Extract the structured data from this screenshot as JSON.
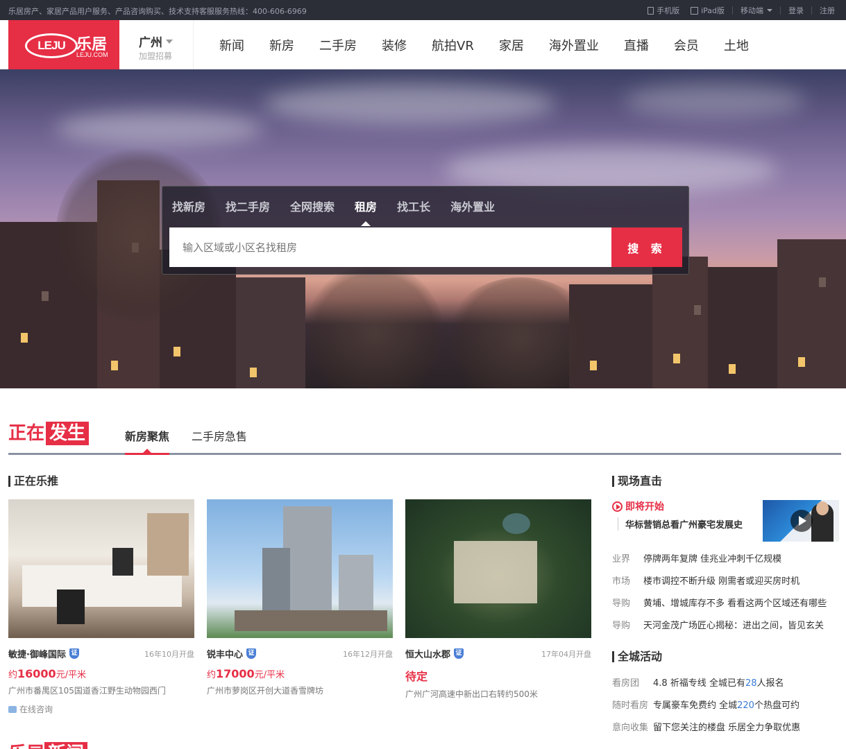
{
  "topbar": {
    "notice": "乐居房产、家居产品用户服务、产品咨询购买、技术支持客服服务热线：400-606-6969",
    "links": [
      "手机版",
      "iPad版",
      "移动端",
      "登录",
      "注册"
    ]
  },
  "header": {
    "logo_mark": "LEJU",
    "logo_cn": "乐居",
    "logo_en": "LEJU.COM",
    "city": "广州",
    "city_sub": "加盟招募",
    "nav": [
      "新闻",
      "新房",
      "二手房",
      "装修",
      "航拍VR",
      "家居",
      "海外置业",
      "直播",
      "会员",
      "土地"
    ]
  },
  "search": {
    "tabs": [
      "找新房",
      "找二手房",
      "全网搜索",
      "租房",
      "找工长",
      "海外置业"
    ],
    "active_tab": "租房",
    "placeholder": "输入区域或小区名找租房",
    "button": "搜 索"
  },
  "section": {
    "title_a": "正在",
    "title_b": "发生",
    "tabs": [
      "新房聚焦",
      "二手房急售"
    ]
  },
  "left": {
    "heading": "正在乐推",
    "cards": [
      {
        "name": "敏捷·御峰国际",
        "badge": "证",
        "date": "16年10月开盘",
        "price_prefix": "约",
        "price": "16000",
        "price_unit": "元/平米",
        "address": "广州市番禺区105国道香江野生动物园西门",
        "consult": "在线咨询"
      },
      {
        "name": "锐丰中心",
        "badge": "证",
        "date": "16年12月开盘",
        "price_prefix": "约",
        "price": "17000",
        "price_unit": "元/平米",
        "address": "广州市萝岗区开创大道香雪牌坊"
      },
      {
        "name": "恒大山水郡",
        "badge": "证",
        "date": "17年04月开盘",
        "price_status": "待定",
        "address": "广州广河高速中新出口右转约500米"
      }
    ]
  },
  "right": {
    "live_heading": "现场直击",
    "live_soon": "即将开始",
    "live_desc": "华标营销总看广州豪宅发展史",
    "news": [
      {
        "k": "业界",
        "v": "停牌两年复牌 佳兆业冲刺千亿规模"
      },
      {
        "k": "市场",
        "v": "楼市调控不断升级 刚需者或迎买房时机"
      },
      {
        "k": "导购",
        "v": "黄埔、增城库存不多 看看这两个区域还有哪些"
      },
      {
        "k": "导购",
        "v": "天河金茂广场匠心揭秘：进出之间，皆见玄关"
      }
    ],
    "events_heading": "全城活动",
    "events": [
      {
        "k": "看房团",
        "pre": "4.8 祈福专线 全城已有",
        "n": "28",
        "post": "人报名"
      },
      {
        "k": "随时看房",
        "pre": "专属豪车免费约 全城",
        "n": "220",
        "post": "个热盘可约"
      },
      {
        "k": "意向收集",
        "pre": "留下您关注的楼盘 乐居全力争取优惠",
        "n": "",
        "post": ""
      }
    ]
  },
  "next_section": {
    "a": "乐居",
    "b": "新闻"
  },
  "colors": {
    "brand": "#e62e45",
    "topbar": "#2b2e37",
    "link_blue": "#3a7bd5"
  }
}
